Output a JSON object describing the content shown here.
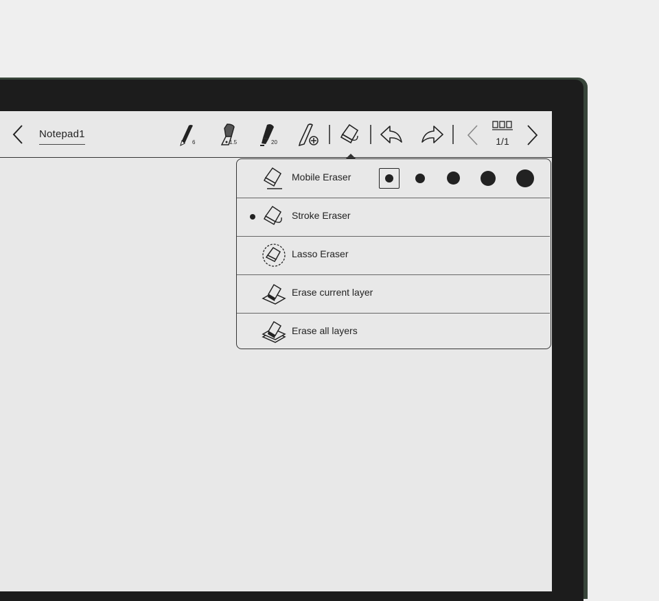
{
  "notepad": {
    "title": "Notepad1"
  },
  "toolbar": {
    "pens": [
      {
        "icon": "pencil-icon",
        "size": "6"
      },
      {
        "icon": "fountain-pen-icon",
        "size": "1.5"
      },
      {
        "icon": "marker-icon",
        "size": "20"
      }
    ],
    "page": {
      "label": "1/1"
    }
  },
  "eraser_menu": {
    "items": [
      {
        "icon": "mobile-eraser-icon",
        "label": "Mobile Eraser",
        "selected": false
      },
      {
        "icon": "stroke-eraser-icon",
        "label": "Stroke Eraser",
        "selected": true
      },
      {
        "icon": "lasso-eraser-icon",
        "label": "Lasso Eraser",
        "selected": false
      },
      {
        "icon": "erase-current-layer-icon",
        "label": "Erase current layer",
        "selected": false
      },
      {
        "icon": "erase-all-layers-icon",
        "label": "Erase all layers",
        "selected": false
      }
    ],
    "eraser_sizes": {
      "count": 5,
      "selected_index": 0
    }
  }
}
